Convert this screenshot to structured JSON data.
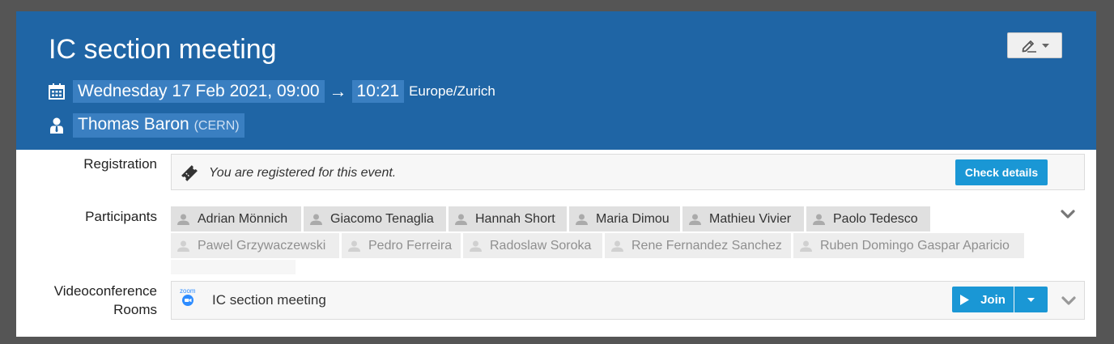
{
  "header": {
    "title": "IC section meeting",
    "date_start": "Wednesday 17 Feb 2021, 09:00",
    "arrow": "→",
    "time_end": "10:21",
    "timezone": "Europe/Zurich",
    "chair_name": "Thomas Baron",
    "chair_affiliation": "(CERN)"
  },
  "registration": {
    "label": "Registration",
    "message": "You are registered for this event.",
    "button": "Check details"
  },
  "participants": {
    "label": "Participants",
    "names": [
      "Adrian Mönnich",
      "Giacomo Tenaglia",
      "Hannah Short",
      "Maria Dimou",
      "Mathieu Vivier",
      "Paolo Tedesco",
      "Pawel Grzywaczewski",
      "Pedro Ferreira",
      "Radoslaw Soroka",
      "Rene Fernandez Sanchez",
      "Ruben Domingo Gaspar Aparicio"
    ]
  },
  "videoconference": {
    "label_line1": "Videoconference",
    "label_line2": "Rooms",
    "provider_logo": "zoom",
    "room_name": "IC section meeting",
    "join_button": "Join"
  },
  "colors": {
    "header_bg": "#1f65a5",
    "highlight_bg": "#3a7fc1",
    "accent_button": "#1a97d5",
    "chip_bg": "#e0e0e0"
  },
  "icons": {
    "calendar": "calendar-icon",
    "person": "person-icon",
    "edit": "pencil-icon",
    "ticket": "ticket-icon",
    "play": "play-icon",
    "chevron": "chevron-down-icon"
  }
}
